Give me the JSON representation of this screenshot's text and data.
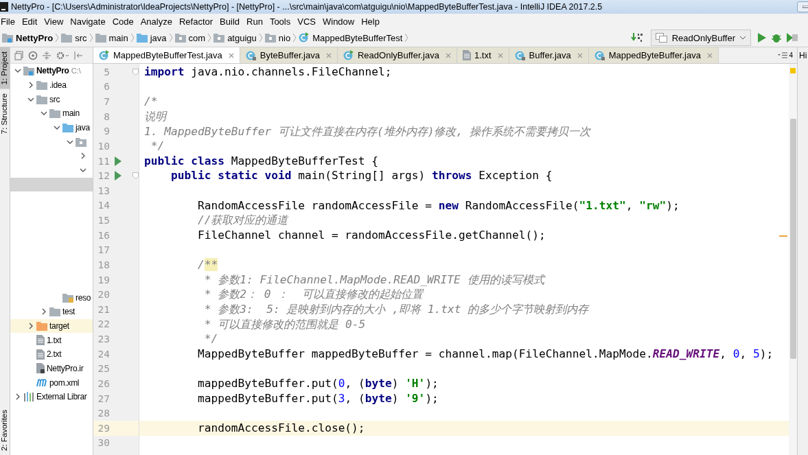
{
  "window": {
    "title": "NettyPro - [C:\\Users\\Administrator\\IdeaProjects\\NettyPro] - [NettyPro] - ...\\src\\main\\java\\com\\atguigu\\nio\\MappedByteBufferTest.java - IntelliJ IDEA 2017.2.5"
  },
  "menu": [
    "File",
    "Edit",
    "View",
    "Navigate",
    "Code",
    "Analyze",
    "Refactor",
    "Build",
    "Run",
    "Tools",
    "VCS",
    "Window",
    "Help"
  ],
  "breadcrumbs": [
    {
      "label": "NettyPro",
      "kind": "module"
    },
    {
      "label": "src",
      "kind": "folder"
    },
    {
      "label": "main",
      "kind": "folder"
    },
    {
      "label": "java",
      "kind": "source"
    },
    {
      "label": "com",
      "kind": "package"
    },
    {
      "label": "atguigu",
      "kind": "package"
    },
    {
      "label": "nio",
      "kind": "package"
    },
    {
      "label": "MappedByteBufferTest",
      "kind": "class"
    }
  ],
  "run_config": {
    "label": "ReadOnlyBuffer"
  },
  "side_tabs": [
    {
      "label": "1: Project",
      "selected": true,
      "kind": "top"
    },
    {
      "label": "7: Structure",
      "selected": false,
      "kind": "top"
    },
    {
      "label": "2: Favorites",
      "selected": false,
      "kind": "bottom"
    }
  ],
  "tree": [
    {
      "label": "NettyPro",
      "path": "C:\\",
      "kind": "module",
      "expanded": true,
      "selected": false,
      "highlighted": false,
      "children": [
        {
          "label": ".idea",
          "kind": "folder",
          "expanded": false,
          "selected": false,
          "highlighted": false
        },
        {
          "label": "src",
          "kind": "folder",
          "expanded": true,
          "selected": false,
          "highlighted": false,
          "children": [
            {
              "label": "main",
              "kind": "folder",
              "expanded": true,
              "selected": false,
              "highlighted": false,
              "children": [
                {
                  "label": "java",
                  "kind": "source",
                  "expanded": true,
                  "selected": false,
                  "highlighted": false,
                  "children": [
                    {
                      "kind": "package",
                      "expanded": true,
                      "selected": false,
                      "highlighted": false,
                      "children": [
                        {
                          "expanded": false,
                          "selected": false,
                          "highlighted": false
                        },
                        {
                          "expanded": true,
                          "selected": false,
                          "highlighted": false,
                          "children": [
                            {
                              "selected": true,
                              "highlighted": false
                            }
                          ]
                        }
                      ]
                    }
                  ]
                },
                {
                  "label": "reso",
                  "kind": "resources",
                  "selected": false,
                  "highlighted": false
                }
              ]
            },
            {
              "label": "test",
              "kind": "folder",
              "expanded": false,
              "selected": false,
              "highlighted": false
            }
          ]
        },
        {
          "label": "target",
          "kind": "excluded",
          "expanded": false,
          "selected": false,
          "highlighted": true
        },
        {
          "label": "1.txt",
          "kind": "text",
          "selected": false,
          "highlighted": false
        },
        {
          "label": "2.txt",
          "kind": "text",
          "selected": false,
          "highlighted": false
        },
        {
          "label": "NettyPro.ir",
          "kind": "iml",
          "selected": false,
          "highlighted": false
        },
        {
          "label": "pom.xml",
          "kind": "maven",
          "selected": false,
          "highlighted": false
        }
      ]
    },
    {
      "label": "External Librar",
      "kind": "library",
      "expanded": false,
      "selected": false,
      "highlighted": false
    }
  ],
  "tabs": [
    {
      "label": "MappedByteBufferTest.java",
      "kind": "runnable",
      "selected": true
    },
    {
      "label": "ByteBuffer.java",
      "kind": "library",
      "selected": false
    },
    {
      "label": "ReadOnlyBuffer.java",
      "kind": "runnable",
      "selected": false
    },
    {
      "label": "1.txt",
      "kind": "text",
      "selected": false
    },
    {
      "label": "Buffer.java",
      "kind": "library",
      "selected": false
    },
    {
      "label": "MappedByteBuffer.java",
      "kind": "library",
      "selected": false
    }
  ],
  "tab_count": "4",
  "right_stripe": {
    "label": "Hi"
  },
  "lines": [
    {
      "n": "5",
      "run": false,
      "fold": true,
      "current": false,
      "tokens": [
        {
          "kind": "kw",
          "text": "import"
        },
        {
          "kind": "plain",
          "text": " java.nio.channels.FileChannel;"
        }
      ]
    },
    {
      "n": "6",
      "run": false,
      "fold": false,
      "current": false
    },
    {
      "n": "7",
      "run": false,
      "fold": false,
      "current": false,
      "tokens": [
        {
          "kind": "comment",
          "text": "/*"
        }
      ]
    },
    {
      "n": "8",
      "run": false,
      "fold": false,
      "current": false,
      "tokens": [
        {
          "kind": "comment",
          "text": "说明"
        }
      ]
    },
    {
      "n": "9",
      "run": false,
      "fold": false,
      "current": false,
      "tokens": [
        {
          "kind": "comment",
          "text": "1. MappedByteBuffer 可让文件直接在内存(堆外内存)修改, 操作系统不需要拷贝一次"
        }
      ]
    },
    {
      "n": "10",
      "run": false,
      "fold": false,
      "current": false,
      "tokens": [
        {
          "kind": "comment",
          "text": " */"
        }
      ]
    },
    {
      "n": "11",
      "run": true,
      "fold": false,
      "current": false,
      "tokens": [
        {
          "kind": "kw",
          "text": "public class"
        },
        {
          "kind": "plain",
          "text": " MappedByteBufferTest {"
        }
      ]
    },
    {
      "n": "12",
      "run": true,
      "fold": true,
      "current": false,
      "tokens": [
        {
          "kind": "kw",
          "text": "    public static void"
        },
        {
          "kind": "plain",
          "text": " main(String[] args) "
        },
        {
          "kind": "kw",
          "text": "throws"
        },
        {
          "kind": "plain",
          "text": " Exception {"
        }
      ]
    },
    {
      "n": "13",
      "run": false,
      "fold": false,
      "current": false
    },
    {
      "n": "14",
      "run": false,
      "fold": false,
      "current": false,
      "tokens": [
        {
          "kind": "plain",
          "text": "        RandomAccessFile randomAccessFile = "
        },
        {
          "kind": "kw",
          "text": "new"
        },
        {
          "kind": "plain",
          "text": " RandomAccessFile("
        },
        {
          "kind": "string",
          "text": "\"1.txt\""
        },
        {
          "kind": "plain",
          "text": ", "
        },
        {
          "kind": "string",
          "text": "\"rw\""
        },
        {
          "kind": "plain",
          "text": ");"
        }
      ]
    },
    {
      "n": "15",
      "run": false,
      "fold": false,
      "current": false,
      "tokens": [
        {
          "kind": "comment",
          "text": "        //获取对应的通道"
        }
      ]
    },
    {
      "n": "16",
      "run": false,
      "fold": false,
      "current": false,
      "tokens": [
        {
          "kind": "plain",
          "text": "        FileChannel channel = randomAccessFile.getChannel();"
        }
      ]
    },
    {
      "n": "17",
      "run": false,
      "fold": false,
      "current": false
    },
    {
      "n": "18",
      "run": false,
      "fold": false,
      "current": false,
      "tokens": [
        {
          "kind": "comment",
          "text": "        /"
        },
        {
          "kind": "match",
          "text": "**"
        }
      ]
    },
    {
      "n": "19",
      "run": false,
      "fold": false,
      "current": false,
      "tokens": [
        {
          "kind": "comment",
          "text": "         * 参数1: FileChannel.MapMode.READ_WRITE 使用的读写模式"
        }
      ]
    },
    {
      "n": "20",
      "run": false,
      "fold": false,
      "current": false,
      "tokens": [
        {
          "kind": "comment",
          "text": "         * 参数2： 0 ：  可以直接修改的起始位置"
        }
      ]
    },
    {
      "n": "21",
      "run": false,
      "fold": false,
      "current": false,
      "tokens": [
        {
          "kind": "comment",
          "text": "         * 参数3:  5: 是映射到内存的大小 ,即将 1.txt 的多少个字节映射到内存"
        }
      ]
    },
    {
      "n": "22",
      "run": false,
      "fold": false,
      "current": false,
      "tokens": [
        {
          "kind": "comment",
          "text": "         * 可以直接修改的范围就是 0-5"
        }
      ]
    },
    {
      "n": "23",
      "run": false,
      "fold": false,
      "current": false,
      "tokens": [
        {
          "kind": "comment",
          "text": "         */"
        }
      ]
    },
    {
      "n": "24",
      "run": false,
      "fold": false,
      "current": false,
      "tokens": [
        {
          "kind": "plain",
          "text": "        MappedByteBuffer mappedByteBuffer = channel.map(FileChannel.MapMode."
        },
        {
          "kind": "field",
          "text": "READ_WRITE"
        },
        {
          "kind": "plain",
          "text": ", "
        },
        {
          "kind": "num",
          "text": "0"
        },
        {
          "kind": "plain",
          "text": ", "
        },
        {
          "kind": "num",
          "text": "5"
        },
        {
          "kind": "plain",
          "text": ");"
        }
      ]
    },
    {
      "n": "25",
      "run": false,
      "fold": false,
      "current": false
    },
    {
      "n": "26",
      "run": false,
      "fold": false,
      "current": false,
      "tokens": [
        {
          "kind": "plain",
          "text": "        mappedByteBuffer.put("
        },
        {
          "kind": "num",
          "text": "0"
        },
        {
          "kind": "plain",
          "text": ", ("
        },
        {
          "kind": "kw",
          "text": "byte"
        },
        {
          "kind": "plain",
          "text": ") "
        },
        {
          "kind": "string",
          "text": "'H'"
        },
        {
          "kind": "plain",
          "text": ");"
        }
      ]
    },
    {
      "n": "27",
      "run": false,
      "fold": false,
      "current": false,
      "tokens": [
        {
          "kind": "plain",
          "text": "        mappedByteBuffer.put("
        },
        {
          "kind": "num",
          "text": "3"
        },
        {
          "kind": "plain",
          "text": ", ("
        },
        {
          "kind": "kw",
          "text": "byte"
        },
        {
          "kind": "plain",
          "text": ") "
        },
        {
          "kind": "string",
          "text": "'9'"
        },
        {
          "kind": "plain",
          "text": ");"
        }
      ]
    },
    {
      "n": "28",
      "run": false,
      "fold": false,
      "current": false
    },
    {
      "n": "29",
      "run": false,
      "fold": false,
      "current": true,
      "tokens": [
        {
          "kind": "plain",
          "text": "        randomAccessFile.close();"
        }
      ]
    },
    {
      "n": "30",
      "run": false,
      "fold": false,
      "current": false
    }
  ]
}
